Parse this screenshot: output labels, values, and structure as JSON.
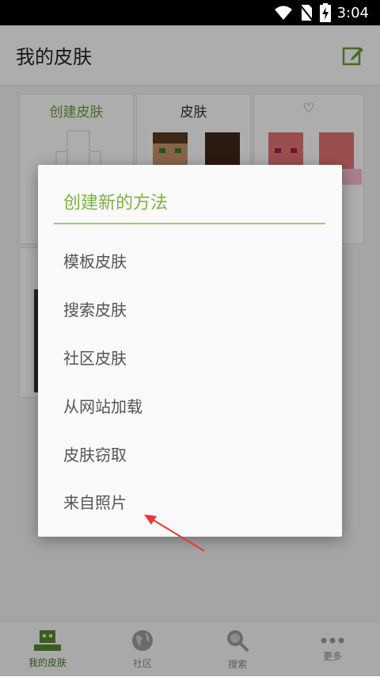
{
  "status_bar": {
    "time": "3:04"
  },
  "app_bar": {
    "title": "我的皮肤"
  },
  "grid": {
    "cards": [
      {
        "label": "创建皮肤"
      },
      {
        "label": "皮肤"
      },
      {
        "label": "♡"
      }
    ]
  },
  "dialog": {
    "title": "创建新的方法",
    "options": [
      {
        "label": "模板皮肤"
      },
      {
        "label": "搜索皮肤"
      },
      {
        "label": "社区皮肤"
      },
      {
        "label": "从网站加载"
      },
      {
        "label": "皮肤窃取"
      },
      {
        "label": "来自照片"
      }
    ]
  },
  "bottom_nav": {
    "items": [
      {
        "label": "我的皮肤",
        "icon": "skin-icon",
        "active": true
      },
      {
        "label": "社区",
        "icon": "globe-icon",
        "active": false
      },
      {
        "label": "搜索",
        "icon": "search-icon",
        "active": false
      },
      {
        "label": "更多",
        "icon": "more-icon",
        "active": false
      }
    ]
  },
  "colors": {
    "accent": "#7cb342",
    "annotation_arrow": "#e53935"
  }
}
